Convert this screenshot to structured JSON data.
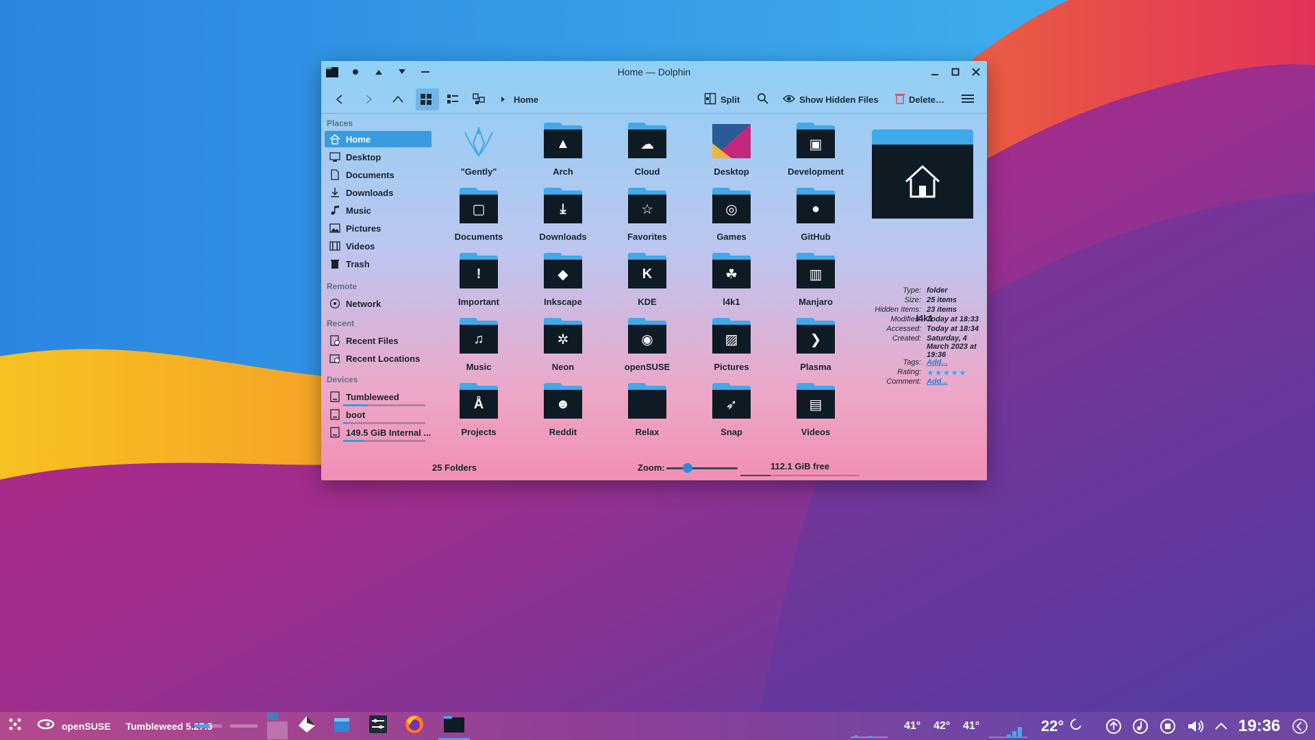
{
  "window": {
    "title": "Home — Dolphin"
  },
  "toolbar": {
    "breadcrumb": "Home",
    "split_label": "Split",
    "hidden_files_label": "Show Hidden Files",
    "delete_label": "Delete…"
  },
  "sidebar": {
    "places_heading": "Places",
    "places": [
      {
        "label": "Home",
        "icon": "home-icon"
      },
      {
        "label": "Desktop",
        "icon": "desktop-icon"
      },
      {
        "label": "Documents",
        "icon": "document-icon"
      },
      {
        "label": "Downloads",
        "icon": "download-icon"
      },
      {
        "label": "Music",
        "icon": "music-icon"
      },
      {
        "label": "Pictures",
        "icon": "picture-icon"
      },
      {
        "label": "Videos",
        "icon": "video-icon"
      },
      {
        "label": "Trash",
        "icon": "trash-icon"
      }
    ],
    "remote_heading": "Remote",
    "remote": [
      {
        "label": "Network",
        "icon": "network-icon"
      }
    ],
    "recent_heading": "Recent",
    "recent": [
      {
        "label": "Recent Files",
        "icon": "recent-files-icon"
      },
      {
        "label": "Recent Locations",
        "icon": "recent-locations-icon"
      }
    ],
    "devices_heading": "Devices",
    "devices": [
      {
        "label": "Tumbleweed",
        "used_fraction": 0.3
      },
      {
        "label": "boot",
        "used_fraction": 0.05
      },
      {
        "label": "149.5 GiB Internal ...",
        "used_fraction": 0.25
      }
    ]
  },
  "folders": [
    {
      "label": "\"Gently\"",
      "glyph": "✧"
    },
    {
      "label": "Arch",
      "glyph": "▲"
    },
    {
      "label": "Cloud",
      "glyph": "☁"
    },
    {
      "label": "Desktop",
      "glyph": ""
    },
    {
      "label": "Development",
      "glyph": "▣"
    },
    {
      "label": "Documents",
      "glyph": "▢"
    },
    {
      "label": "Downloads",
      "glyph": "⤓"
    },
    {
      "label": "Favorites",
      "glyph": "☆"
    },
    {
      "label": "Games",
      "glyph": "◎"
    },
    {
      "label": "GitHub",
      "glyph": "●"
    },
    {
      "label": "Important",
      "glyph": "!"
    },
    {
      "label": "Inkscape",
      "glyph": "◆"
    },
    {
      "label": "KDE",
      "glyph": "K"
    },
    {
      "label": "l4k1",
      "glyph": "☘"
    },
    {
      "label": "Manjaro",
      "glyph": "▥"
    },
    {
      "label": "Music",
      "glyph": "♫"
    },
    {
      "label": "Neon",
      "glyph": "✲"
    },
    {
      "label": "openSUSE",
      "glyph": "◉"
    },
    {
      "label": "Pictures",
      "glyph": "▨"
    },
    {
      "label": "Plasma",
      "glyph": "❯"
    },
    {
      "label": "Projects",
      "glyph": "Å"
    },
    {
      "label": "Reddit",
      "glyph": "☻"
    },
    {
      "label": "Relax",
      "glyph": ""
    },
    {
      "label": "Snap",
      "glyph": "➶"
    },
    {
      "label": "Videos",
      "glyph": "▤"
    }
  ],
  "info": {
    "name": "l4k1",
    "fields": [
      {
        "k": "Type:",
        "v": "folder"
      },
      {
        "k": "Size:",
        "v": "25 items"
      },
      {
        "k": "Hidden Items:",
        "v": "23 items"
      },
      {
        "k": "Modified:",
        "v": "Today at 18:33"
      },
      {
        "k": "Accessed:",
        "v": "Today at 18:34"
      },
      {
        "k": "Created:",
        "v": "Saturday, 4 March 2023 at 19:36"
      },
      {
        "k": "Tags:",
        "v": "Add..."
      },
      {
        "k": "Rating:",
        "v": "★★★★★"
      },
      {
        "k": "Comment:",
        "v": "Add..."
      }
    ],
    "rating": 5
  },
  "status": {
    "folders": "25 Folders",
    "zoom_label": "Zoom:",
    "free": "112.1 GiB free"
  },
  "taskbar": {
    "distro": "openSUSE",
    "version": "Tumbleweed 5.27.5",
    "temps": [
      "41°",
      "42°",
      "41°"
    ],
    "weather": "22°",
    "clock": "19:36"
  },
  "colors": {
    "accent": "#3a9be0",
    "folder_body": "#0f1b24",
    "folder_tab": "#3fa9ea"
  }
}
